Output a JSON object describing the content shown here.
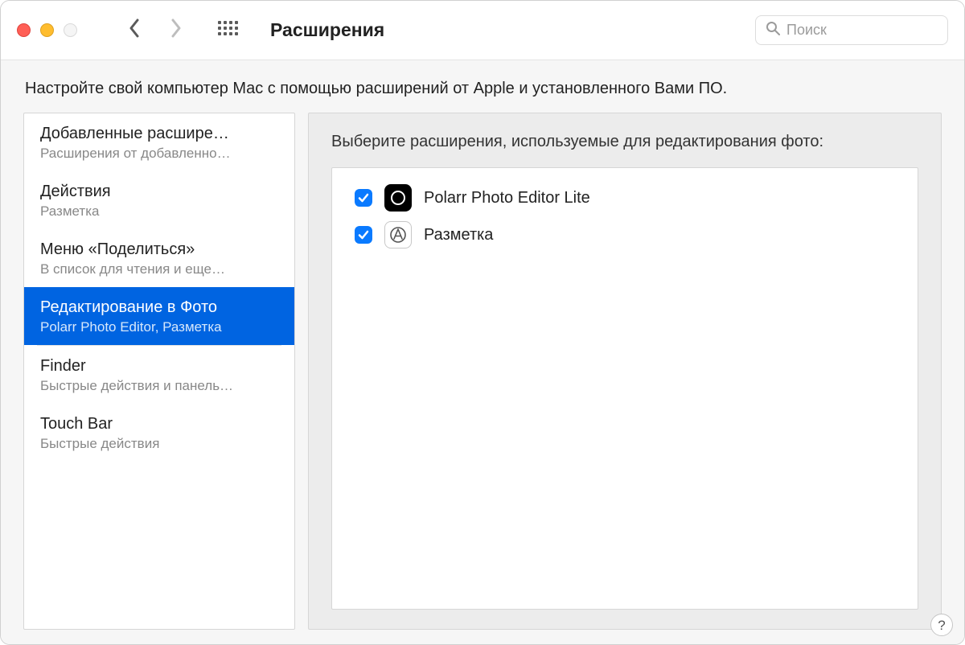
{
  "header": {
    "title": "Расширения",
    "search_placeholder": "Поиск"
  },
  "description": "Настройте свой компьютер Mac с помощью расширений от Apple и установленного Вами ПО.",
  "sidebar": {
    "items": [
      {
        "title": "Добавленные расшире…",
        "subtitle": "Расширения от добавленно…",
        "selected": false
      },
      {
        "title": "Действия",
        "subtitle": "Разметка",
        "selected": false
      },
      {
        "title": "Меню «Поделиться»",
        "subtitle": "В список для чтения и еще…",
        "selected": false
      },
      {
        "title": "Редактирование в Фото",
        "subtitle": "Polarr Photo Editor, Разметка",
        "selected": true
      },
      {
        "title": "Finder",
        "subtitle": "Быстрые действия и панель…",
        "selected": false
      },
      {
        "title": "Touch Bar",
        "subtitle": "Быстрые действия",
        "selected": false
      }
    ]
  },
  "detail": {
    "heading": "Выберите расширения, используемые для редактирования фото:",
    "extensions": [
      {
        "name": "Polarr Photo Editor Lite",
        "checked": true,
        "icon": "polarr-icon"
      },
      {
        "name": "Разметка",
        "checked": true,
        "icon": "markup-icon"
      }
    ]
  },
  "help_label": "?"
}
